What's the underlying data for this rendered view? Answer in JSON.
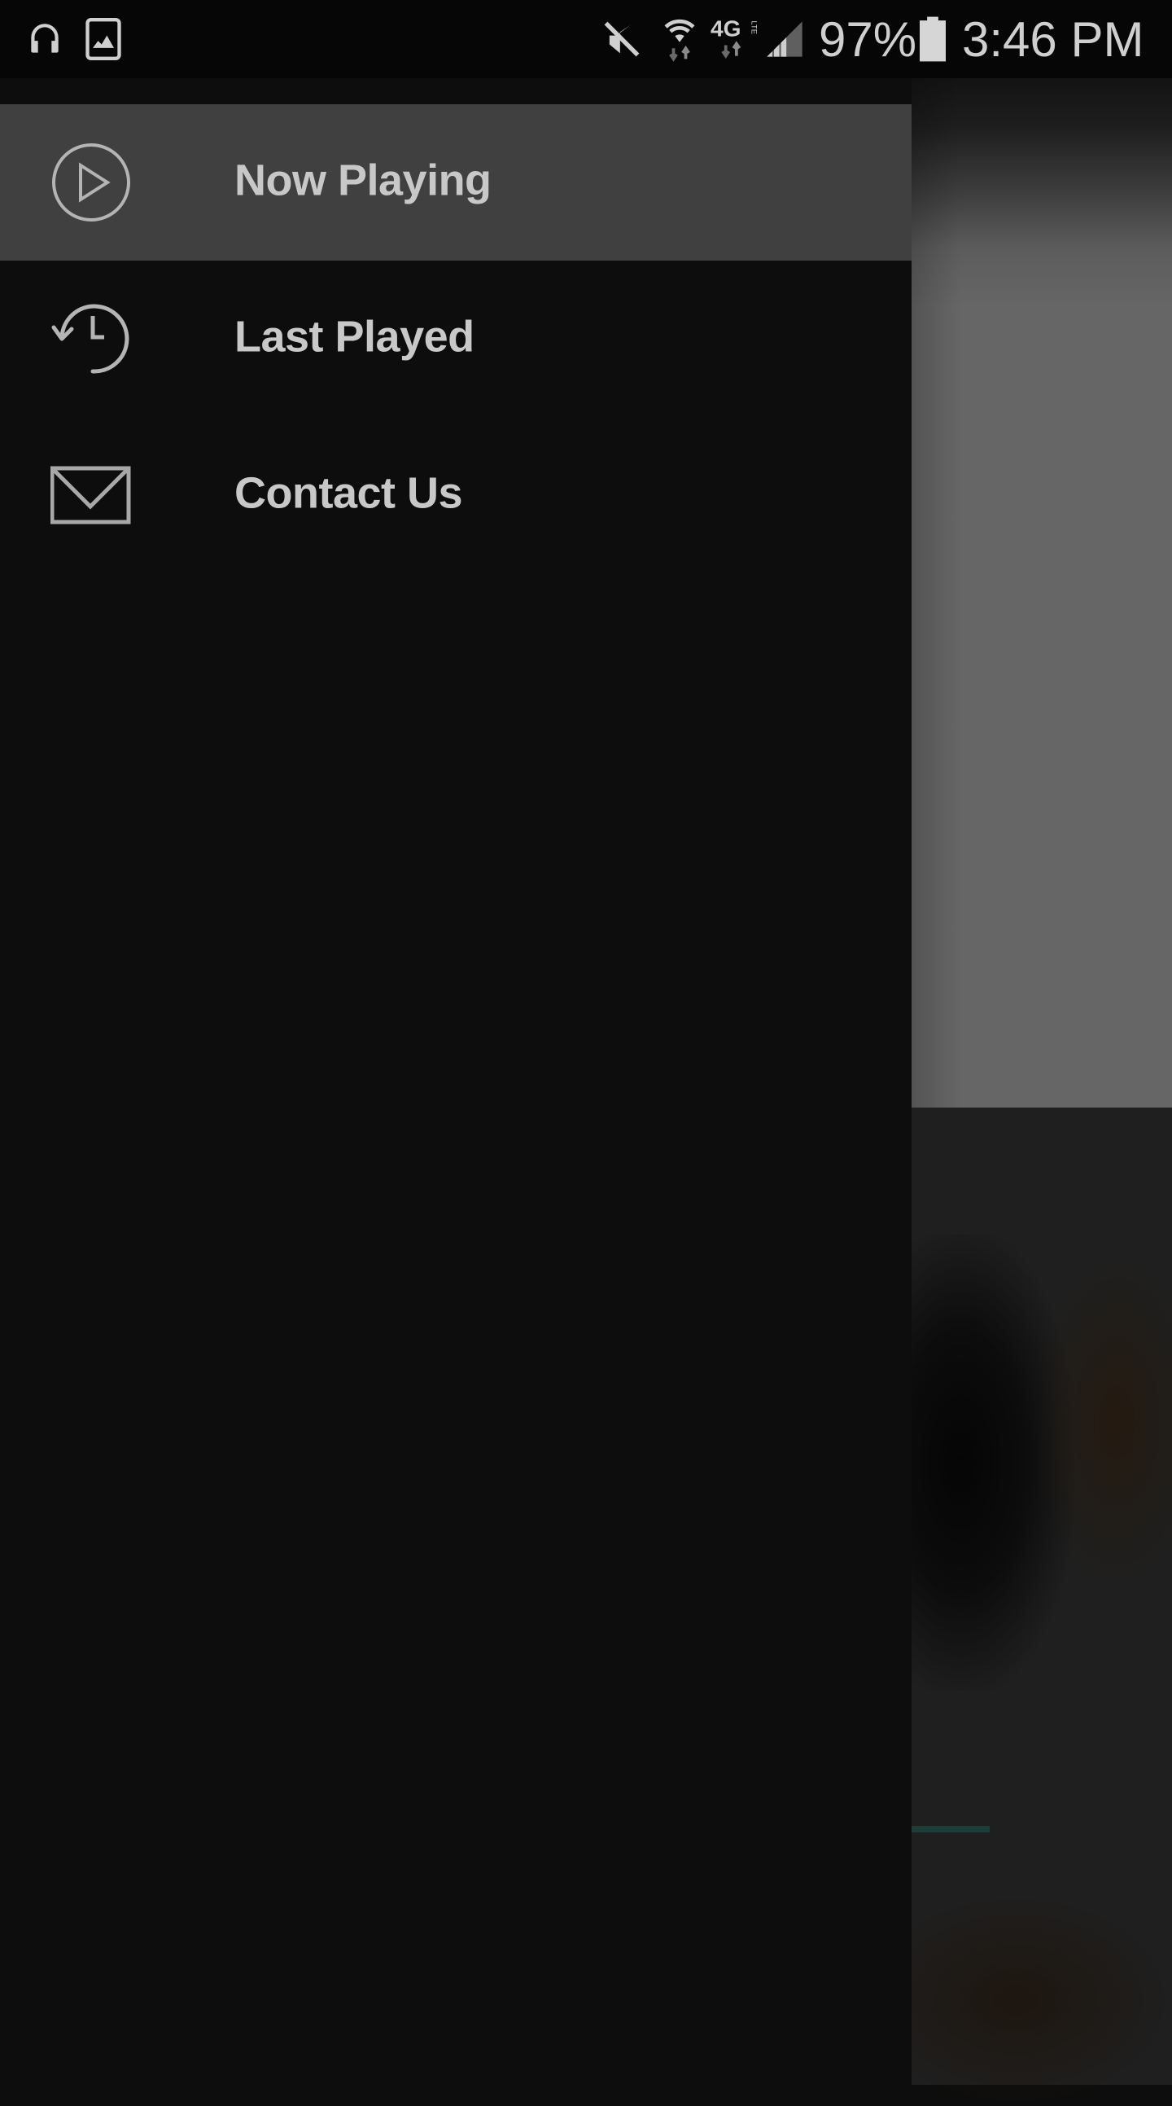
{
  "status_bar": {
    "left_icons": [
      "headphones-icon",
      "image-icon"
    ],
    "right_icons": [
      "mute-icon",
      "wifi-icon",
      "network-4g-lte-icon",
      "signal-icon",
      "battery-icon"
    ],
    "network_label": "4G",
    "network_sublabel": "LTE",
    "battery_percent": "97%",
    "time": "3:46 PM"
  },
  "drawer": {
    "items": [
      {
        "label": "Now Playing",
        "icon": "play-circle-icon",
        "active": true
      },
      {
        "label": "Last Played",
        "icon": "history-icon",
        "active": false
      },
      {
        "label": "Contact Us",
        "icon": "mail-icon",
        "active": false
      }
    ]
  },
  "background_app": {
    "accent_color": "#1e3d36",
    "progress_bar_visible": true
  }
}
